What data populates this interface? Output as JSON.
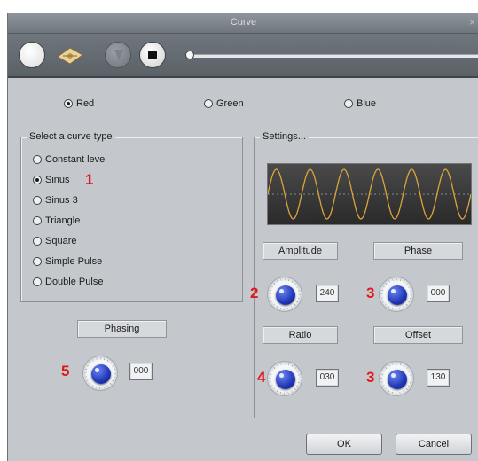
{
  "window": {
    "title": "Curve",
    "close_glyph": "×"
  },
  "toolbar": {
    "buttons": [
      {
        "icon": "white-circle-icon"
      },
      {
        "icon": "pin-icon"
      },
      {
        "icon": "disabled-play-icon"
      },
      {
        "icon": "stop-icon"
      }
    ],
    "slider_position": 0.0
  },
  "color_channels": [
    {
      "label": "Red",
      "checked": true
    },
    {
      "label": "Green",
      "checked": false
    },
    {
      "label": "Blue",
      "checked": false
    }
  ],
  "curve_type": {
    "legend": "Select a curve type",
    "options": [
      {
        "label": "Constant level",
        "checked": false
      },
      {
        "label": "Sinus",
        "checked": true
      },
      {
        "label": "Sinus 3",
        "checked": false
      },
      {
        "label": "Triangle",
        "checked": false
      },
      {
        "label": "Square",
        "checked": false
      },
      {
        "label": "Simple Pulse",
        "checked": false
      },
      {
        "label": "Double Pulse",
        "checked": false
      }
    ]
  },
  "settings": {
    "legend": "Settings...",
    "waveform_color": "#d9a53b",
    "amplitude": {
      "label": "Amplitude",
      "value": "240"
    },
    "phase": {
      "label": "Phase",
      "value": "000"
    },
    "ratio": {
      "label": "Ratio",
      "value": "030"
    },
    "offset": {
      "label": "Offset",
      "value": "130"
    }
  },
  "phasing": {
    "label": "Phasing",
    "value": "000"
  },
  "annotations": {
    "sinus": "1",
    "amplitude": "2",
    "phase": "3",
    "ratio": "4",
    "offset": "3",
    "phasing": "5"
  },
  "buttons": {
    "ok": "OK",
    "cancel": "Cancel"
  },
  "colors": {
    "annotation": "#e01818",
    "knob": "#1f36b8",
    "panel": "#c4c8cc"
  }
}
